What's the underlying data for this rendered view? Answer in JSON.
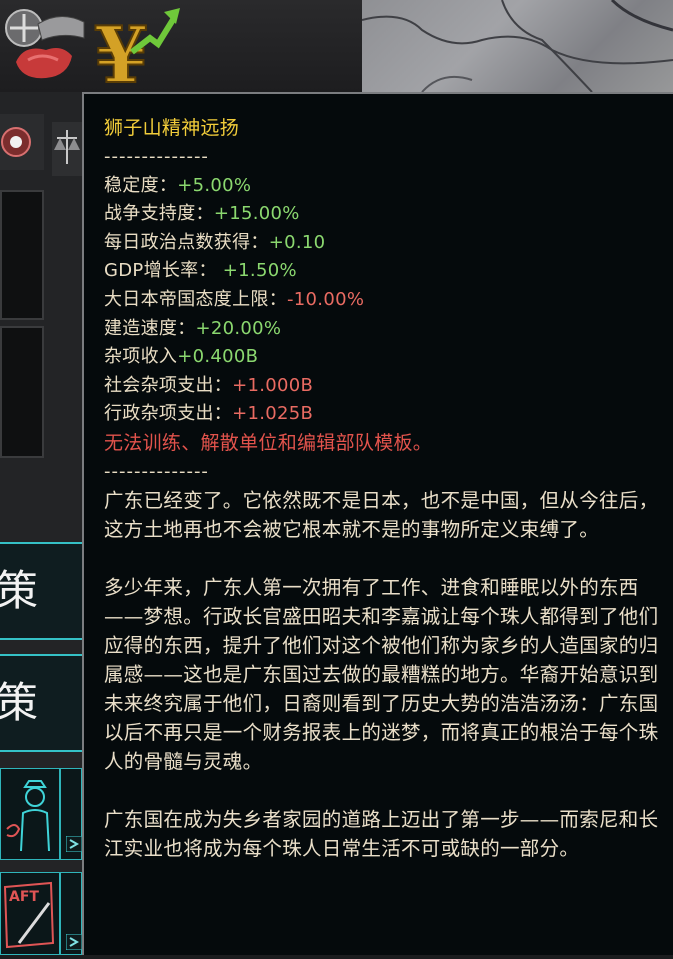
{
  "tooltip": {
    "title": "狮子山精神远扬",
    "separator": "--------------",
    "modifiers": [
      {
        "label": "稳定度：",
        "value": "+5.00%",
        "tone": "pos"
      },
      {
        "label": "战争支持度：",
        "value": "+15.00%",
        "tone": "pos"
      },
      {
        "label": "每日政治点数获得：",
        "value": "+0.10",
        "tone": "pos"
      },
      {
        "label": "GDP增长率： ",
        "value": "+1.50%",
        "tone": "pos"
      },
      {
        "label": "大日本帝国态度上限：",
        "value": "-10.00%",
        "tone": "neg"
      },
      {
        "label": "建造速度：",
        "value": "+20.00%",
        "tone": "pos"
      },
      {
        "label": "杂项收入",
        "value": "+0.400B",
        "tone": "pos"
      },
      {
        "label": "社会杂项支出：",
        "value": "+1.000B",
        "tone": "neg"
      },
      {
        "label": "行政杂项支出：",
        "value": "+1.025B",
        "tone": "neg"
      }
    ],
    "warning": "无法训练、解散单位和编辑部队模板。",
    "description": [
      "广东已经变了。它依然既不是日本，也不是中国，但从今往后，这方土地再也不会被它根本就不是的事物所定义束缚了。",
      "多少年来，广东人第一次拥有了工作、进食和睡眠以外的东西——梦想。行政长官盛田昭夫和李嘉诚让每个珠人都得到了他们应得的东西，提升了他们对这个被他们称为家乡的人造国家的归属感——这也是广东国过去做的最糟糕的地方。华裔开始意识到未来终究属于他们，日裔则看到了历史大势的浩浩汤汤：广东国以后不再只是一个财务报表上的迷梦，而将真正的根治于每个珠人的骨髓与灵魂。",
      "广东国在成为失乡者家园的道路上迈出了第一步——而索尼和长江实业也将成为每个珠人日常生活不可或缺的一部分。"
    ]
  },
  "left_panel": {
    "policy_1": "策",
    "policy_2": "策",
    "draft_label": "AFT"
  },
  "colors": {
    "title": "#f2cd3a",
    "positive": "#8bd86f",
    "negative": "#e96b62",
    "warning": "#e2534c",
    "accent_cyan": "#35c1c6"
  },
  "icons": [
    "flag-emblem-icon",
    "money-growth-icon",
    "cog-icon",
    "scales-icon",
    "police-officer-icon",
    "draft-paper-icon",
    "expand-arrow-icon"
  ]
}
